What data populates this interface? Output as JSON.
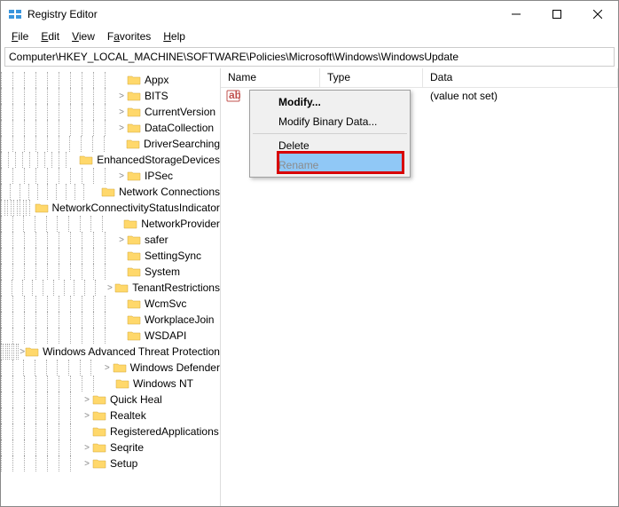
{
  "window": {
    "title": "Registry Editor"
  },
  "menubar": {
    "file": "File",
    "edit": "Edit",
    "view": "View",
    "favorites": "Favorites",
    "help": "Help"
  },
  "address": "Computer\\HKEY_LOCAL_MACHINE\\SOFTWARE\\Policies\\Microsoft\\Windows\\WindowsUpdate",
  "tree": {
    "items": [
      {
        "indent": 10,
        "expander": "",
        "label": "Appx"
      },
      {
        "indent": 10,
        "expander": ">",
        "label": "BITS"
      },
      {
        "indent": 10,
        "expander": ">",
        "label": "CurrentVersion"
      },
      {
        "indent": 10,
        "expander": ">",
        "label": "DataCollection"
      },
      {
        "indent": 10,
        "expander": "",
        "label": "DriverSearching"
      },
      {
        "indent": 10,
        "expander": "",
        "label": "EnhancedStorageDevices"
      },
      {
        "indent": 10,
        "expander": ">",
        "label": "IPSec"
      },
      {
        "indent": 10,
        "expander": "",
        "label": "Network Connections"
      },
      {
        "indent": 10,
        "expander": "",
        "label": "NetworkConnectivityStatusIndicator"
      },
      {
        "indent": 10,
        "expander": "",
        "label": "NetworkProvider"
      },
      {
        "indent": 10,
        "expander": ">",
        "label": "safer"
      },
      {
        "indent": 10,
        "expander": "",
        "label": "SettingSync"
      },
      {
        "indent": 10,
        "expander": "",
        "label": "System"
      },
      {
        "indent": 10,
        "expander": ">",
        "label": "TenantRestrictions"
      },
      {
        "indent": 10,
        "expander": "",
        "label": "WcmSvc"
      },
      {
        "indent": 10,
        "expander": "",
        "label": "WorkplaceJoin"
      },
      {
        "indent": 10,
        "expander": "",
        "label": "WSDAPI"
      },
      {
        "indent": 9,
        "expander": ">",
        "label": "Windows Advanced Threat Protection"
      },
      {
        "indent": 9,
        "expander": ">",
        "label": "Windows Defender"
      },
      {
        "indent": 9,
        "expander": "",
        "label": "Windows NT"
      },
      {
        "indent": 7,
        "expander": ">",
        "label": "Quick Heal"
      },
      {
        "indent": 7,
        "expander": ">",
        "label": "Realtek"
      },
      {
        "indent": 7,
        "expander": "",
        "label": "RegisteredApplications"
      },
      {
        "indent": 7,
        "expander": ">",
        "label": "Seqrite"
      },
      {
        "indent": 7,
        "expander": ">",
        "label": "Setup"
      }
    ]
  },
  "list": {
    "headers": {
      "name": "Name",
      "type": "Type",
      "data": "Data"
    },
    "row": {
      "data": "(value not set)"
    }
  },
  "context_menu": {
    "modify": "Modify...",
    "modify_binary": "Modify Binary Data...",
    "delete": "Delete",
    "rename": "Rename"
  }
}
